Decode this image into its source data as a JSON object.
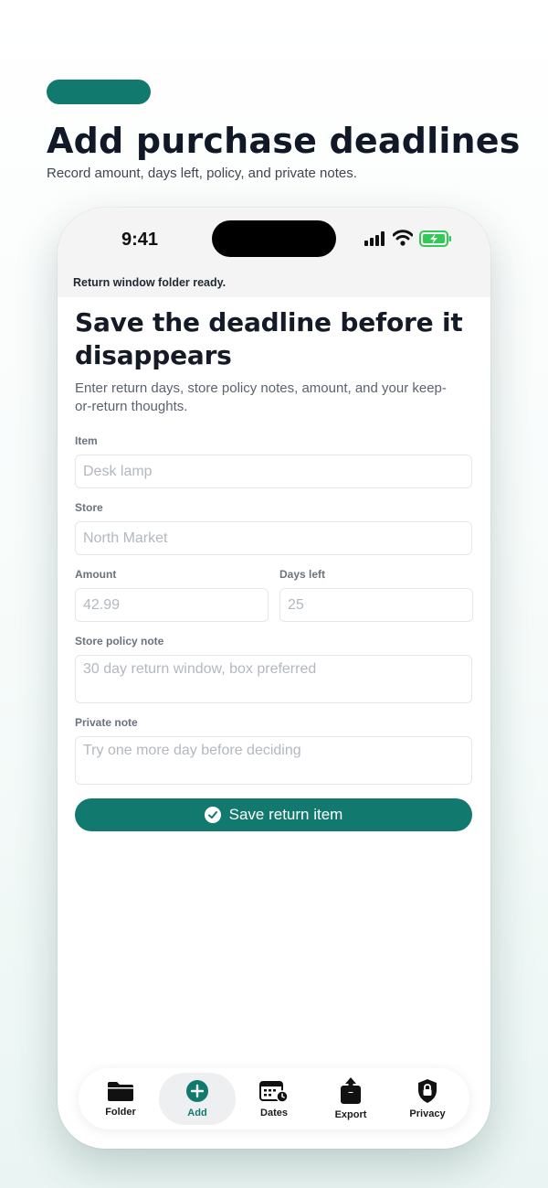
{
  "hero": {
    "title": "Add purchase deadlines",
    "subtitle": "Record amount, days left, policy, and private notes."
  },
  "status": {
    "time": "9:41"
  },
  "toast": "Return window folder ready.",
  "form": {
    "title": "Save the deadline before it disappears",
    "description": "Enter return days, store policy notes, amount, and your keep-or-return thoughts.",
    "item_label": "Item",
    "item_placeholder": "Desk lamp",
    "store_label": "Store",
    "store_placeholder": "North Market",
    "amount_label": "Amount",
    "amount_placeholder": "42.99",
    "days_label": "Days left",
    "days_placeholder": "25",
    "policy_label": "Store policy note",
    "policy_placeholder": "30 day return window, box preferred",
    "private_label": "Private note",
    "private_placeholder": "Try one more day before deciding",
    "save_label": "Save return item"
  },
  "tabs": [
    {
      "label": "Folder",
      "icon": "folder-icon",
      "active": false
    },
    {
      "label": "Add",
      "icon": "plus-circle-icon",
      "active": true
    },
    {
      "label": "Dates",
      "icon": "calendar-clock-icon",
      "active": false
    },
    {
      "label": "Export",
      "icon": "share-icon",
      "active": false
    },
    {
      "label": "Privacy",
      "icon": "lock-shield-icon",
      "active": false
    }
  ],
  "colors": {
    "accent": "#11796d",
    "battery": "#34c759"
  }
}
